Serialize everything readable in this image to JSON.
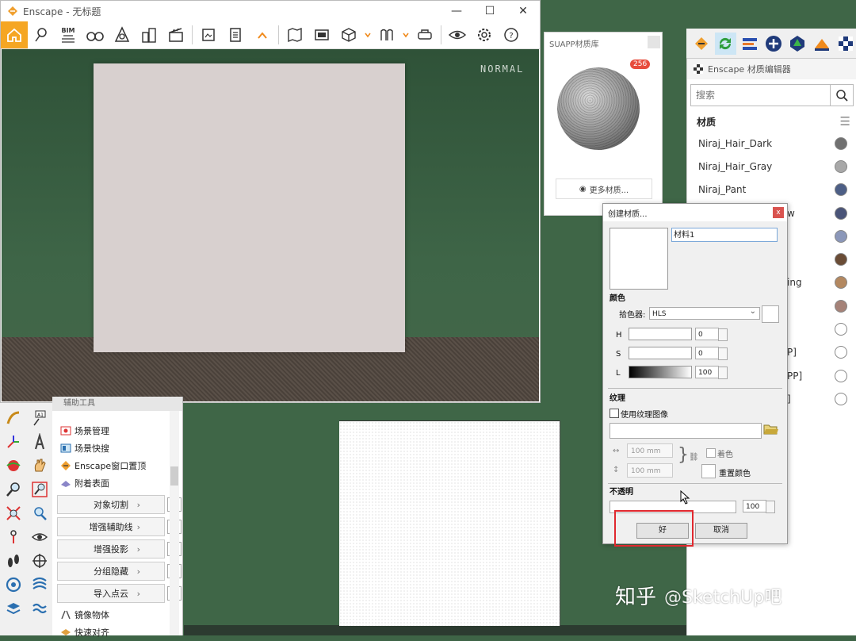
{
  "enscape_window": {
    "title": "Enscape - 无标题",
    "controls": {
      "minimize": "—",
      "maximize": "☐",
      "close": "✕"
    },
    "toolbar": {
      "bim_label": "BIM"
    },
    "viewport_mode": "NORMAL"
  },
  "suapp_library": {
    "title": "SUAPP材质库",
    "count": "256",
    "more_button": "更多材质..."
  },
  "material_editor": {
    "title": "Enscape 材质编辑器",
    "search_placeholder": "搜索",
    "section_label": "材质",
    "materials": [
      {
        "name": "Niraj_Hair_Dark",
        "color": "#707070"
      },
      {
        "name": "Niraj_Hair_Gray",
        "color": "#a8a8a8"
      },
      {
        "name": "Niraj_Pant",
        "color": "#4d5f86"
      },
      {
        "name": "",
        "color": "#4a5478"
      },
      {
        "name": "",
        "color": "#8b97b9"
      },
      {
        "name": "",
        "color": "#6a4c36"
      },
      {
        "name": "",
        "color": "#b38860"
      },
      {
        "name": "",
        "color": "#a58278"
      },
      {
        "name": "",
        "color": "#ffffff"
      },
      {
        "name": "",
        "color": "#ffffff"
      },
      {
        "name": "",
        "color": "#ffffff"
      },
      {
        "name": "",
        "color": "#ffffff"
      }
    ],
    "partial_texts": [
      "w",
      "ing",
      "P]",
      "PP]",
      "]"
    ]
  },
  "create_material_dialog": {
    "title": "创建材质...",
    "close_label": "x",
    "name_value": "材料1",
    "color_label": "颜色",
    "picker_label": "拾色器:",
    "picker_value": "HLS",
    "channels": [
      {
        "label": "H",
        "value": "0"
      },
      {
        "label": "S",
        "value": "0"
      },
      {
        "label": "L",
        "value": "100"
      }
    ],
    "texture_label": "纹理",
    "use_texture_label": "使用纹理图像",
    "width_value": "100 mm",
    "height_value": "100 mm",
    "tint_label": "着色",
    "reset_color_label": "重置颜色",
    "opacity_label": "不透明",
    "opacity_value": "100",
    "ok_label": "好",
    "cancel_label": "取消"
  },
  "aux_tools": {
    "header": "辅助工具",
    "items": [
      "场景管理",
      "场景快搜",
      "Enscape窗口置顶",
      "附着表面"
    ],
    "buttons": [
      "对象切割",
      "增强辅助线",
      "增强投影",
      "分组隐藏",
      "导入点云"
    ],
    "bottom_items": [
      "镜像物体",
      "快速对齐"
    ]
  },
  "watermark": {
    "site": "知乎",
    "handle": "@SketchUp吧"
  }
}
